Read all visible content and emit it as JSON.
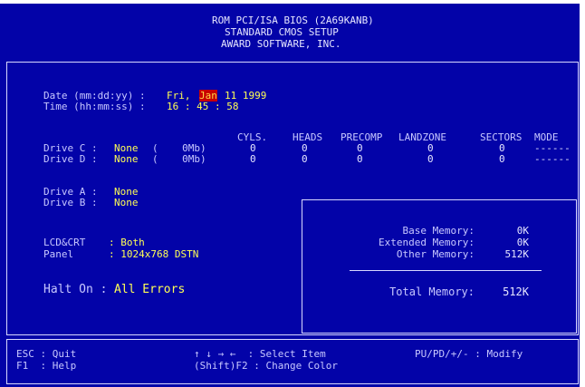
{
  "header": {
    "line1": "ROM PCI/ISA BIOS (2A69KANB)",
    "line2": "STANDARD CMOS SETUP",
    "line3": "AWARD SOFTWARE, INC."
  },
  "date": {
    "label": "Date (mm:dd:yy) :",
    "day": "Fri,",
    "month": "Jan",
    "rest": "11 1999"
  },
  "time": {
    "label": "Time (hh:mm:ss) :",
    "value": "16 : 45 : 58"
  },
  "drive_table": {
    "columns": [
      "CYLS.",
      "HEADS",
      "PRECOMP",
      "LANDZONE",
      "SECTORS",
      "MODE"
    ],
    "rows": [
      {
        "label": "Drive C :",
        "type": "None",
        "size": "(    0Mb)",
        "cyls": "0",
        "heads": "0",
        "precomp": "0",
        "landzone": "0",
        "sectors": "0",
        "mode": "------"
      },
      {
        "label": "Drive D :",
        "type": "None",
        "size": "(    0Mb)",
        "cyls": "0",
        "heads": "0",
        "precomp": "0",
        "landzone": "0",
        "sectors": "0",
        "mode": "------"
      }
    ]
  },
  "floppy": {
    "a_label": "Drive A :",
    "a_value": "None",
    "b_label": "Drive B :",
    "b_value": "None"
  },
  "lcd_crt": {
    "label": "LCD&CRT",
    "value": ": Both"
  },
  "panel": {
    "label": "Panel",
    "value": ": 1024x768 DSTN"
  },
  "halt_on": {
    "label": "Halt On :",
    "value": "All Errors"
  },
  "memory": {
    "base_label": "Base Memory:",
    "base_value": "0K",
    "extended_label": "Extended Memory:",
    "extended_value": "0K",
    "other_label": "Other Memory:",
    "other_value": "512K",
    "total_label": "Total Memory:",
    "total_value": "512K"
  },
  "footer": {
    "esc": "ESC : Quit",
    "f1": "F1  : Help",
    "select": "↑ ↓ → ←  : Select Item",
    "modify": "PU/PD/+/- : Modify",
    "color": "(Shift)F2 : Change Color"
  },
  "colors": {
    "background": "#0303a8",
    "text": "#c8c8ff",
    "value": "#ffff55",
    "highlight": "#c80000"
  }
}
